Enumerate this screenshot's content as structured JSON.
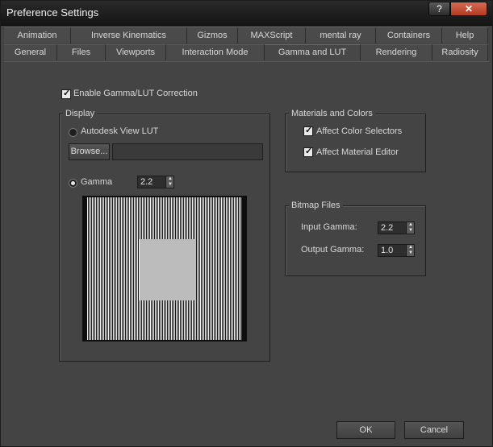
{
  "window": {
    "title": "Preference Settings",
    "help_label": "?",
    "close_label": "✕"
  },
  "tabs_top": [
    "Animation",
    "Inverse Kinematics",
    "Gizmos",
    "MAXScript",
    "mental ray",
    "Containers",
    "Help"
  ],
  "tabs_bottom": [
    "General",
    "Files",
    "Viewports",
    "Interaction Mode",
    "Gamma and LUT",
    "Rendering",
    "Radiosity"
  ],
  "selected_tab": "Gamma and LUT",
  "enable_gamma": {
    "label": "Enable Gamma/LUT Correction",
    "checked": true
  },
  "display": {
    "title": "Display",
    "lut_label": "Autodesk View LUT",
    "browse_label": "Browse...",
    "lut_path": "",
    "gamma_label": "Gamma",
    "gamma_value": "2.2"
  },
  "materials": {
    "title": "Materials and Colors",
    "affect_color_selectors": "Affect Color Selectors",
    "affect_material_editor": "Affect Material Editor"
  },
  "bitmap": {
    "title": "Bitmap Files",
    "input_label": "Input Gamma:",
    "input_value": "2.2",
    "output_label": "Output Gamma:",
    "output_value": "1.0"
  },
  "buttons": {
    "ok": "OK",
    "cancel": "Cancel"
  }
}
